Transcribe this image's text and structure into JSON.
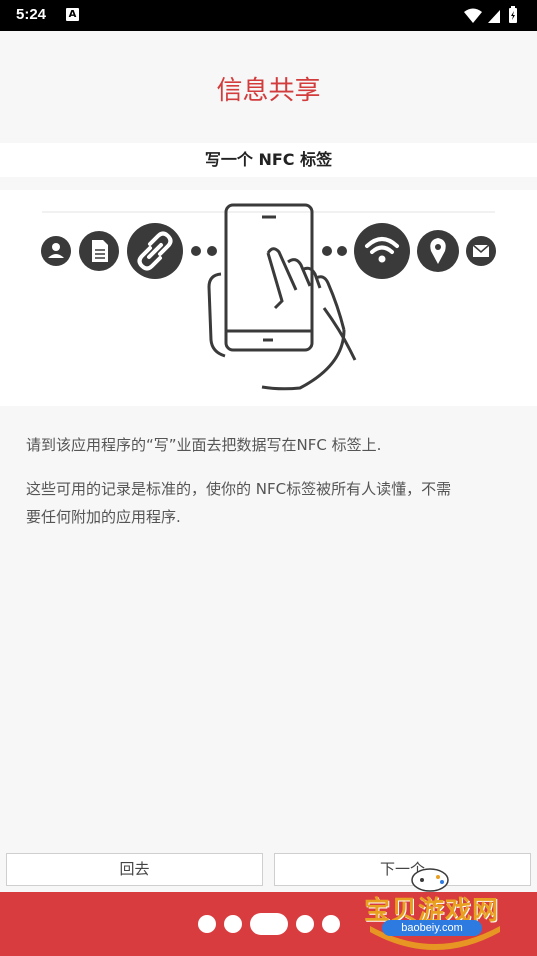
{
  "status_bar": {
    "time": "5:24",
    "notification_icon": "A"
  },
  "header": {
    "title": "信息共享"
  },
  "subtitle": "写一个 NFC 标签",
  "illustration": {
    "icons": [
      "contact-icon",
      "document-icon",
      "link-icon",
      "phone-hand-icon",
      "wifi-icon",
      "location-icon",
      "mail-icon"
    ]
  },
  "description": {
    "paragraph1": "请到该应用程序的“写”业面去把数据写在NFC 标签上.",
    "paragraph2_line1": "这些可用的记录是标准的，使你的 NFC标签被所有人读懂，不需",
    "paragraph2_line2": "要任何附加的应用程序."
  },
  "buttons": {
    "back": "回去",
    "next": "下一个"
  },
  "pager": {
    "count": 5,
    "active_index": 2
  },
  "watermark": {
    "text": "宝贝游戏网",
    "url": "baobeiy.com"
  },
  "colors": {
    "accent": "#d93c3f",
    "title": "#d23c3c"
  }
}
